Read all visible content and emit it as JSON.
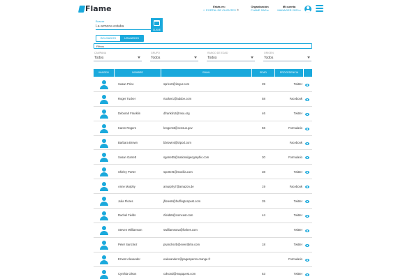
{
  "app": {
    "brand": "Flame"
  },
  "header": {
    "estas_en": {
      "label": "Estás en:",
      "value": "☆ PORTAL DE CLIENTES"
    },
    "organizacion": {
      "label": "Organización",
      "value": "FLAME SAS ▾"
    },
    "cuenta": {
      "label": "Mi cuenta",
      "value": "MANAGER 2020 ▾"
    }
  },
  "search": {
    "label": "Buscar",
    "value": "La armona estaba",
    "button_label": "CLAVE"
  },
  "toggle": {
    "left": "BOLSADOS",
    "right": "USUARIOS"
  },
  "filter": {
    "label": "Filtros"
  },
  "selects": [
    {
      "label": "CAMPANA",
      "value": "Todos"
    },
    {
      "label": "GRUPO",
      "value": "Todos"
    },
    {
      "label": "RANGO DE EDAD",
      "value": "Todos"
    },
    {
      "label": "ORIGEN",
      "value": "Todos"
    }
  ],
  "table": {
    "headers": [
      "IMAGEN",
      "NOMBRE",
      "EMAIL",
      "EDAD",
      "PROCEDENCIA",
      ""
    ],
    "rows": [
      {
        "name": "Susan Price",
        "email": "sprice0@imgur.com",
        "age": "39",
        "source": "Twitter"
      },
      {
        "name": "Roger Tucker",
        "email": "rtucker1@adobe.com",
        "age": "58",
        "source": "Facebook"
      },
      {
        "name": "Deborah Franklin",
        "email": "dfranklin2@msu.org",
        "age": "46",
        "source": "Twitter"
      },
      {
        "name": "Karen Rogers",
        "email": "krogers3@census.gov",
        "age": "56",
        "source": "Formulario"
      },
      {
        "name": "Barbara Brown",
        "email": "bbrown4@tripod.com",
        "age": "",
        "source": "Facebook"
      },
      {
        "name": "Susan Garrett",
        "email": "sgarrett5@nationalgeographic.com",
        "age": "30",
        "source": "Formulario"
      },
      {
        "name": "Shirley Porter",
        "email": "sporter6@mozilla.com",
        "age": "38",
        "source": "Twitter"
      },
      {
        "name": "Anne Murphy",
        "email": "amurphy7@amazon.de",
        "age": "19",
        "source": "Facebook"
      },
      {
        "name": "Julia Flores",
        "email": "jflores8@huffingtonpost.com",
        "age": "35",
        "source": "Twitter"
      },
      {
        "name": "Rachel Fields",
        "email": "rfields9@comcast.com",
        "age": "44",
        "source": "Twitter"
      },
      {
        "name": "Steven Williamson",
        "email": "swilliamsona@forbes.com",
        "age": "",
        "source": "Twitter"
      },
      {
        "name": "Peter Sanchez",
        "email": "psanchezb@eventbrite.com",
        "age": "18",
        "source": "Twitter"
      },
      {
        "name": "Ernest Alexander",
        "email": "ealexanderc@pagesperso-orange.fr",
        "age": "",
        "source": "Formulario"
      },
      {
        "name": "Cynthia Olson",
        "email": "colsond@mapquest.com",
        "age": "53",
        "source": "Twitter"
      }
    ]
  },
  "colors": {
    "accent": "#1aa9dc",
    "text": "#333333",
    "brand_dark": "#2b2f36"
  }
}
